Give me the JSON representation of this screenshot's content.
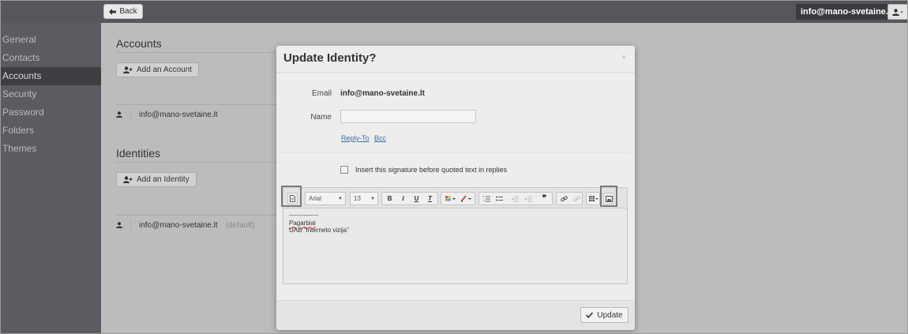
{
  "topbar": {
    "back_label": "Back",
    "account_email": "info@mano-svetaine.lt"
  },
  "sidebar": {
    "items": [
      {
        "label": "General"
      },
      {
        "label": "Contacts"
      },
      {
        "label": "Accounts",
        "active": true
      },
      {
        "label": "Security"
      },
      {
        "label": "Password"
      },
      {
        "label": "Folders"
      },
      {
        "label": "Themes"
      }
    ]
  },
  "main": {
    "accounts": {
      "title": "Accounts",
      "add_label": "Add an Account",
      "rows": [
        {
          "email": "info@mano-svetaine.lt"
        }
      ]
    },
    "identities": {
      "title": "Identities",
      "add_label": "Add an Identity",
      "rows": [
        {
          "email": "info@mano-svetaine.lt",
          "tag": "(default)"
        }
      ]
    }
  },
  "modal": {
    "title": "Update Identity?",
    "close_glyph": "×",
    "email_label": "Email",
    "email_value": "info@mano-svetaine.lt",
    "name_label": "Name",
    "name_value": "",
    "reply_to_link": "Reply-To",
    "bcc_link": "Bcc",
    "signature_checkbox_label": "Insert this signature before quoted text in replies",
    "signature_checkbox_checked": false,
    "editor": {
      "font_family": "Arial",
      "font_size": "13",
      "bold": "B",
      "italic": "I",
      "underline": "U",
      "clear_format": "T",
      "blockquote": "❞",
      "signature_lines": [
        "--------------",
        "Pagarbiai",
        "UAB \"Interneto vizija\""
      ]
    },
    "update_label": "Update"
  }
}
